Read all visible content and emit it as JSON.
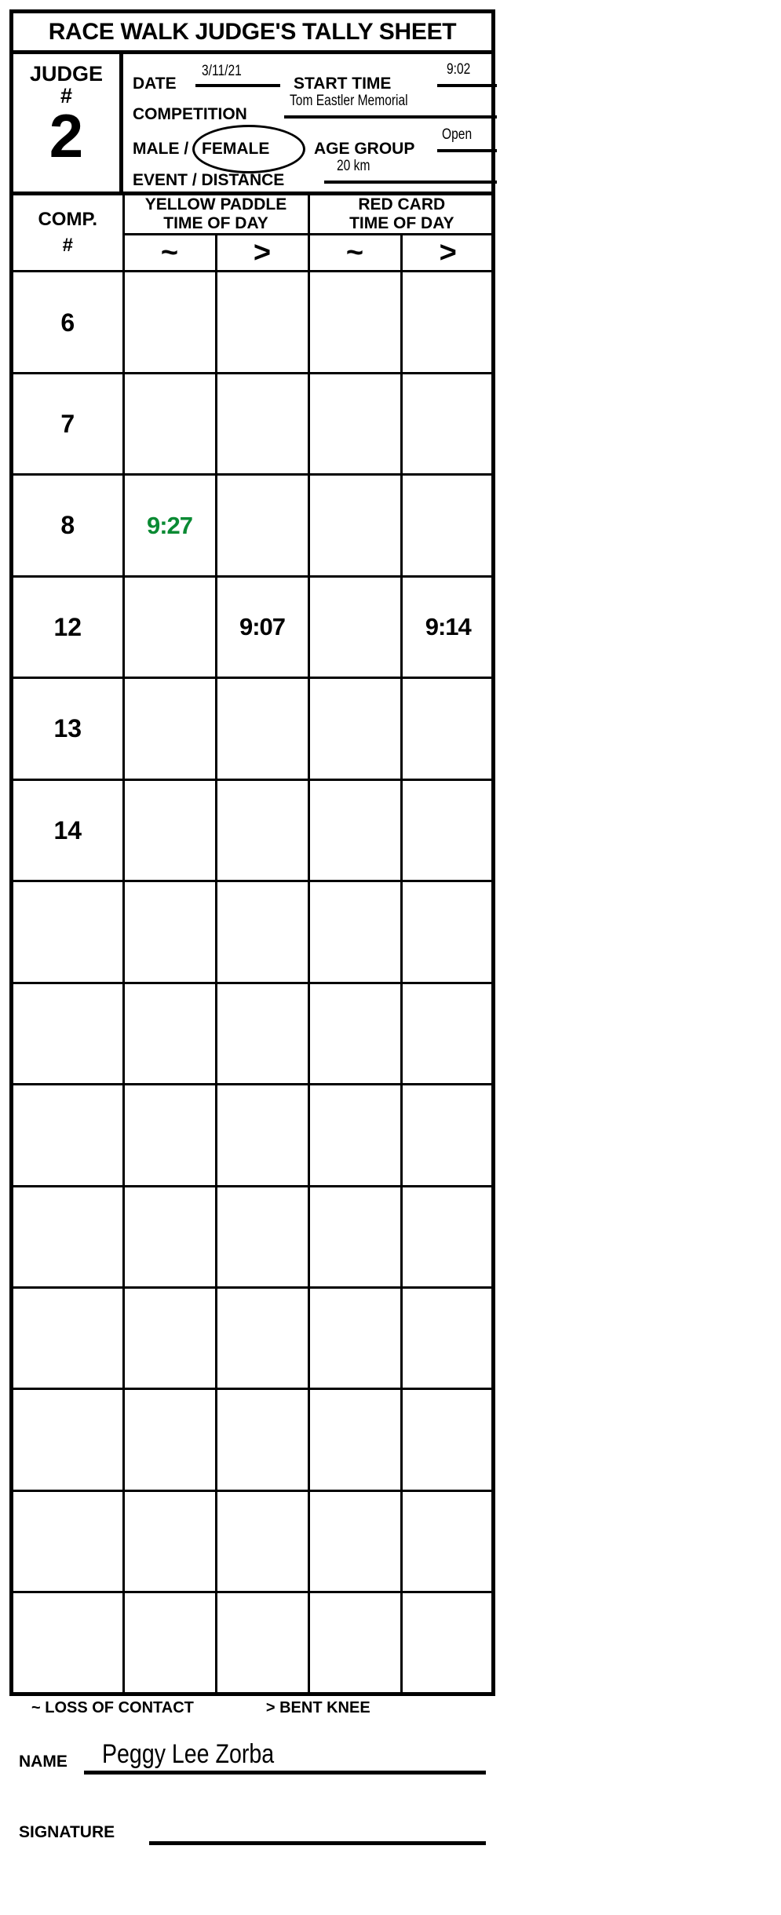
{
  "title": "RACE WALK JUDGE'S TALLY SHEET",
  "judge": {
    "label_line1": "JUDGE",
    "label_line2": "#",
    "number": "2"
  },
  "fields": {
    "date_label": "DATE",
    "date_value": "3/11/21",
    "start_time_label": "START TIME",
    "start_time_value": "9:02",
    "competition_label": "COMPETITION",
    "competition_value": "Tom Eastler Memorial",
    "male_label": "MALE /",
    "female_label": "FEMALE",
    "age_group_label": "AGE GROUP",
    "age_group_value": "Open",
    "event_distance_label": "EVENT / DISTANCE",
    "event_distance_value": "20 km",
    "circled_gender": "FEMALE"
  },
  "table": {
    "comp_header_line1": "COMP.",
    "comp_header_line2": "#",
    "group_yellow": "YELLOW PADDLE\nTIME OF DAY",
    "group_yellow_line1": "YELLOW PADDLE",
    "group_yellow_line2": "TIME OF DAY",
    "group_red": "RED CARD\nTIME OF DAY",
    "group_red_line1": "RED CARD",
    "group_red_line2": "TIME OF DAY",
    "symbols": [
      "~",
      ">",
      "~",
      ">"
    ],
    "rows": [
      {
        "comp": "6",
        "flag": "",
        "yellow_tilde": "",
        "yellow_gt": "",
        "red_tilde": "",
        "red_gt": "",
        "yellow_tilde_color": ""
      },
      {
        "comp": "7",
        "flag": "",
        "yellow_tilde": "",
        "yellow_gt": "",
        "red_tilde": "",
        "red_gt": "",
        "yellow_tilde_color": ""
      },
      {
        "comp": "8",
        "flag": "",
        "yellow_tilde": "9:27",
        "yellow_gt": "",
        "red_tilde": "",
        "red_gt": "",
        "yellow_tilde_color": "#0a8a33"
      },
      {
        "comp": "12",
        "flag": ">",
        "yellow_tilde": "",
        "yellow_gt": "9:07",
        "red_tilde": "",
        "red_gt": "9:14",
        "yellow_tilde_color": ""
      },
      {
        "comp": "13",
        "flag": "",
        "yellow_tilde": "",
        "yellow_gt": "",
        "red_tilde": "",
        "red_gt": "",
        "yellow_tilde_color": ""
      },
      {
        "comp": "14",
        "flag": "",
        "yellow_tilde": "",
        "yellow_gt": "",
        "red_tilde": "",
        "red_gt": "",
        "yellow_tilde_color": ""
      },
      {
        "comp": "",
        "flag": "",
        "yellow_tilde": "",
        "yellow_gt": "",
        "red_tilde": "",
        "red_gt": "",
        "yellow_tilde_color": ""
      },
      {
        "comp": "",
        "flag": "",
        "yellow_tilde": "",
        "yellow_gt": "",
        "red_tilde": "",
        "red_gt": "",
        "yellow_tilde_color": ""
      },
      {
        "comp": "",
        "flag": "",
        "yellow_tilde": "",
        "yellow_gt": "",
        "red_tilde": "",
        "red_gt": "",
        "yellow_tilde_color": ""
      },
      {
        "comp": "",
        "flag": "",
        "yellow_tilde": "",
        "yellow_gt": "",
        "red_tilde": "",
        "red_gt": "",
        "yellow_tilde_color": ""
      },
      {
        "comp": "",
        "flag": "",
        "yellow_tilde": "",
        "yellow_gt": "",
        "red_tilde": "",
        "red_gt": "",
        "yellow_tilde_color": ""
      },
      {
        "comp": "",
        "flag": "",
        "yellow_tilde": "",
        "yellow_gt": "",
        "red_tilde": "",
        "red_gt": "",
        "yellow_tilde_color": ""
      },
      {
        "comp": "",
        "flag": "",
        "yellow_tilde": "",
        "yellow_gt": "",
        "red_tilde": "",
        "red_gt": "",
        "yellow_tilde_color": ""
      },
      {
        "comp": "",
        "flag": "",
        "yellow_tilde": "",
        "yellow_gt": "",
        "red_tilde": "",
        "red_gt": "",
        "yellow_tilde_color": ""
      }
    ]
  },
  "legend": {
    "loss_of_contact": "~ LOSS OF CONTACT",
    "bent_knee": "> BENT KNEE"
  },
  "footer": {
    "name_label": "NAME",
    "name_value": "Peggy Lee Zorba",
    "signature_label": "SIGNATURE",
    "signature_value": ""
  },
  "colors": {
    "ink": "#000000",
    "green": "#0a8a33",
    "paper": "#ffffff"
  }
}
